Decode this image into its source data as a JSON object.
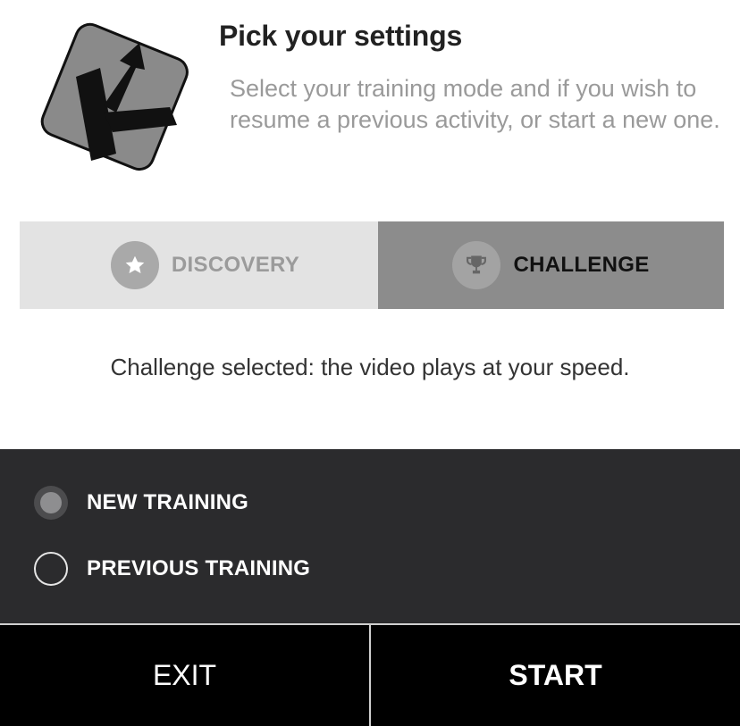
{
  "header": {
    "logo_icon": "k-arrow-logo",
    "title": "Pick your settings",
    "subtitle": "Select your training mode and if you wish to resume a previous activity, or start a new one."
  },
  "mode_tabs": [
    {
      "label": "DISCOVERY",
      "icon": "star-icon",
      "selected": false
    },
    {
      "label": "CHALLENGE",
      "icon": "trophy-icon",
      "selected": true
    }
  ],
  "status_text": "Challenge selected: the video plays at your speed.",
  "options": [
    {
      "label": "NEW TRAINING",
      "checked": true
    },
    {
      "label": "PREVIOUS TRAINING",
      "checked": false
    }
  ],
  "footer": {
    "exit_label": "EXIT",
    "start_label": "START"
  },
  "colors": {
    "options_bg": "#2b2b2d",
    "tab_unselected_bg": "#e3e3e3",
    "tab_selected_bg": "#8c8c8c",
    "footer_bg": "#000000"
  }
}
